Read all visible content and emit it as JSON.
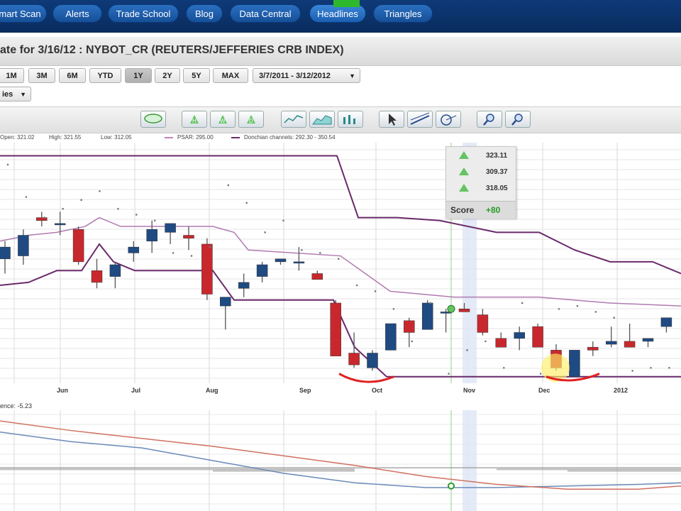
{
  "nav": {
    "items": [
      "mart Scan",
      "Alerts",
      "Trade School",
      "Blog",
      "Data Central",
      "Headlines",
      "Triangles"
    ]
  },
  "title": "ate for 3/16/12 : NYBOT_CR (REUTERS/JEFFERIES CRB INDEX)",
  "range": {
    "buttons": [
      "1M",
      "3M",
      "6M",
      "YTD",
      "1Y",
      "2Y",
      "5Y",
      "MAX"
    ],
    "selected": "1Y",
    "date_range": "3/7/2011 - 3/12/2012"
  },
  "series_select": "ies",
  "info": {
    "open": "Open: 321.02",
    "high": "High: 321.55",
    "low": "Low: 312.05",
    "psar": "PSAR: 295.00",
    "donchian": "Donchian channels: 292.30 - 350.54"
  },
  "score_panel": {
    "values": [
      "323.11",
      "309.37",
      "318.05"
    ],
    "score_label": "Score",
    "score_value": "+80"
  },
  "lower_panel": {
    "label": "ence: -5.23"
  },
  "colors": {
    "bull": "#1f4a82",
    "bear": "#c8282d",
    "donchian": "#6a2a6a",
    "psar": "#777777",
    "nav_bg": "#0e3a78",
    "score_green": "#2a9a2a",
    "annotation": "#e02020"
  },
  "chart_data": [
    {
      "type": "candlestick",
      "title": "NYBOT_CR (REUTERS/JEFFERIES CRB INDEX)",
      "x_ticks": [
        "Jun",
        "Jul",
        "Aug",
        "Sep",
        "Oct",
        "Nov",
        "Dec",
        "2012"
      ],
      "ylim": [
        285,
        365
      ],
      "grid": true,
      "candles": [
        {
          "o": 327,
          "h": 333,
          "l": 322,
          "c": 331
        },
        {
          "o": 328,
          "h": 337,
          "l": 325,
          "c": 335
        },
        {
          "o": 341,
          "h": 343,
          "l": 338,
          "c": 340
        },
        {
          "o": 339,
          "h": 343,
          "l": 335,
          "c": 339
        },
        {
          "o": 337,
          "h": 338,
          "l": 325,
          "c": 326
        },
        {
          "o": 323,
          "h": 327,
          "l": 317,
          "c": 319
        },
        {
          "o": 321,
          "h": 326,
          "l": 317,
          "c": 325
        },
        {
          "o": 329,
          "h": 333,
          "l": 326,
          "c": 331
        },
        {
          "o": 333,
          "h": 340,
          "l": 329,
          "c": 337
        },
        {
          "o": 336,
          "h": 338,
          "l": 332,
          "c": 339
        },
        {
          "o": 335,
          "h": 338,
          "l": 330,
          "c": 334
        },
        {
          "o": 332,
          "h": 334,
          "l": 313,
          "c": 315
        },
        {
          "o": 311,
          "h": 313,
          "l": 303,
          "c": 314
        },
        {
          "o": 317,
          "h": 322,
          "l": 314,
          "c": 319
        },
        {
          "o": 321,
          "h": 326,
          "l": 319,
          "c": 325
        },
        {
          "o": 326,
          "h": 327,
          "l": 325,
          "c": 327
        },
        {
          "o": 326,
          "h": 331,
          "l": 323,
          "c": 326
        },
        {
          "o": 322,
          "h": 323,
          "l": 320,
          "c": 320
        },
        {
          "o": 312,
          "h": 313,
          "l": 294,
          "c": 294
        },
        {
          "o": 295,
          "h": 302,
          "l": 290,
          "c": 291
        },
        {
          "o": 290,
          "h": 296,
          "l": 289,
          "c": 295
        },
        {
          "o": 296,
          "h": 305,
          "l": 296,
          "c": 305
        },
        {
          "o": 306,
          "h": 307,
          "l": 297,
          "c": 302
        },
        {
          "o": 303,
          "h": 313,
          "l": 303,
          "c": 312
        },
        {
          "o": 309,
          "h": 310,
          "l": 302,
          "c": 309
        },
        {
          "o": 310,
          "h": 312,
          "l": 309,
          "c": 309
        },
        {
          "o": 308,
          "h": 310,
          "l": 301,
          "c": 302
        },
        {
          "o": 300,
          "h": 302,
          "l": 298,
          "c": 297
        },
        {
          "o": 300,
          "h": 304,
          "l": 296,
          "c": 302
        },
        {
          "o": 304,
          "h": 305,
          "l": 297,
          "c": 297
        },
        {
          "o": 296,
          "h": 298,
          "l": 289,
          "c": 290
        },
        {
          "o": 287,
          "h": 296,
          "l": 287,
          "c": 296
        },
        {
          "o": 297,
          "h": 299,
          "l": 294,
          "c": 296
        },
        {
          "o": 298,
          "h": 304,
          "l": 297,
          "c": 299
        },
        {
          "o": 299,
          "h": 305,
          "l": 298,
          "c": 297
        },
        {
          "o": 299,
          "h": 300,
          "l": 297,
          "c": 300
        },
        {
          "o": 304,
          "h": 307,
          "l": 302,
          "c": 307
        }
      ],
      "psar": [
        359,
        348,
        341,
        344,
        347,
        350,
        344,
        342,
        340,
        329,
        328,
        331,
        352,
        346,
        336,
        340,
        330,
        329,
        327,
        318,
        316,
        310,
        299,
        312,
        288,
        296,
        299,
        290,
        312,
        288,
        310,
        311,
        309,
        307,
        289,
        290,
        290
      ],
      "donchian_upper": [
        [
          0,
          362
        ],
        [
          30,
          362
        ],
        [
          60,
          362
        ],
        [
          100,
          362
        ],
        [
          140,
          362
        ],
        [
          180,
          362
        ],
        [
          220,
          362
        ],
        [
          260,
          362
        ],
        [
          300,
          362
        ],
        [
          340,
          362
        ],
        [
          380,
          362
        ],
        [
          420,
          362
        ],
        [
          475,
          362
        ],
        [
          505,
          341
        ],
        [
          560,
          341
        ],
        [
          620,
          340
        ],
        [
          700,
          336
        ],
        [
          760,
          336
        ],
        [
          810,
          330
        ],
        [
          860,
          326
        ],
        [
          920,
          326
        ],
        [
          960,
          322
        ]
      ],
      "donchian_lower": [
        [
          0,
          318
        ],
        [
          40,
          319
        ],
        [
          80,
          323
        ],
        [
          115,
          323
        ],
        [
          140,
          332
        ],
        [
          160,
          326
        ],
        [
          190,
          323
        ],
        [
          230,
          323
        ],
        [
          300,
          323
        ],
        [
          330,
          313
        ],
        [
          350,
          313
        ],
        [
          470,
          313
        ],
        [
          500,
          297
        ],
        [
          545,
          287
        ],
        [
          960,
          287
        ]
      ],
      "donchian_mid": [
        [
          0,
          333
        ],
        [
          40,
          335
        ],
        [
          80,
          336
        ],
        [
          120,
          338
        ],
        [
          140,
          341
        ],
        [
          170,
          338
        ],
        [
          230,
          338
        ],
        [
          300,
          338
        ],
        [
          330,
          336
        ],
        [
          350,
          330
        ],
        [
          480,
          328
        ],
        [
          550,
          316
        ],
        [
          640,
          314
        ],
        [
          760,
          314
        ],
        [
          860,
          312
        ],
        [
          960,
          311
        ]
      ]
    },
    {
      "type": "line",
      "ylim": [
        -30,
        30
      ],
      "series": [
        {
          "name": "",
          "color": "#6a8ab8",
          "values": [
            [
              0,
              18
            ],
            [
              100,
              12
            ],
            [
              200,
              8
            ],
            [
              300,
              0
            ],
            [
              400,
              -8
            ],
            [
              500,
              -14
            ],
            [
              600,
              -17
            ],
            [
              700,
              -17
            ],
            [
              800,
              -16
            ],
            [
              900,
              -15
            ],
            [
              960,
              -14
            ]
          ]
        },
        {
          "name": "",
          "color": "#d07060",
          "values": [
            [
              0,
              25
            ],
            [
              100,
              19
            ],
            [
              200,
              14
            ],
            [
              300,
              9
            ],
            [
              400,
              3
            ],
            [
              500,
              -3
            ],
            [
              600,
              -10
            ],
            [
              700,
              -15
            ],
            [
              800,
              -18
            ],
            [
              900,
              -18
            ],
            [
              960,
              -16
            ]
          ]
        }
      ],
      "histogram": [
        [
          0,
          -6
        ],
        [
          100,
          -6
        ],
        [
          200,
          -6
        ],
        [
          300,
          -7
        ],
        [
          400,
          -7
        ],
        [
          500,
          -5
        ],
        [
          600,
          -3
        ],
        [
          700,
          -2
        ],
        [
          800,
          -1
        ],
        [
          900,
          -1
        ],
        [
          960,
          -2
        ]
      ]
    }
  ]
}
